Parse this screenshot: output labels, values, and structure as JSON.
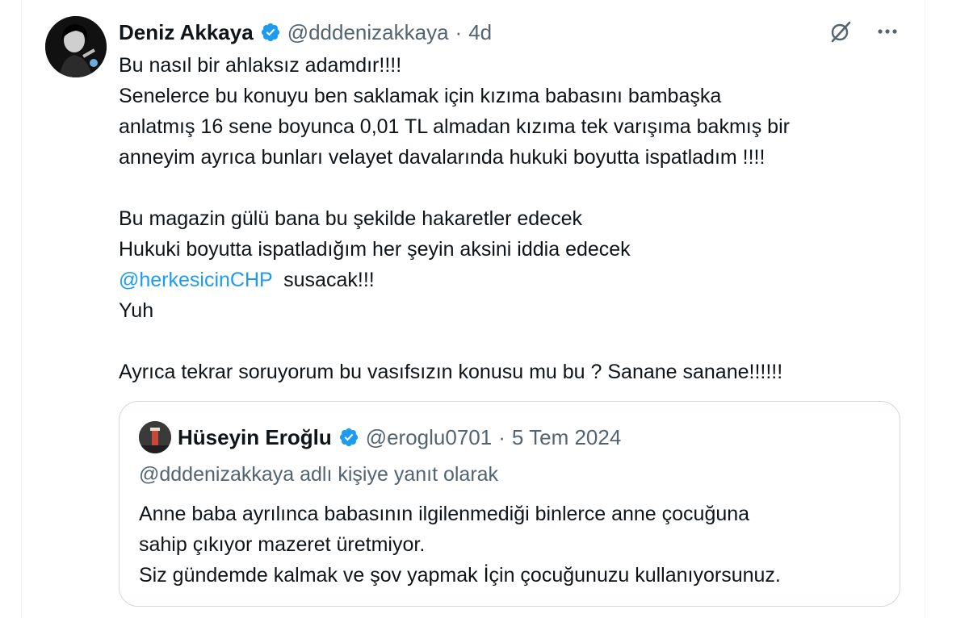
{
  "tweet": {
    "author_name": "Deniz Akkaya",
    "author_handle": "@dddenizakkaya",
    "separator": "·",
    "time": "4d",
    "lines": [
      "Bu nasıl bir ahlaksız adamdır!!!!",
      "Senelerce bu konuyu ben saklamak için kızıma babasını bambaşka",
      "anlatmış 16 sene boyunca 0,01 TL almadan kızıma tek varışıma bakmış bir",
      "anneyim ayrıca bunları velayet davalarında hukuki boyutta ispatladım !!!!",
      "",
      "Bu magazin gülü bana bu şekilde hakaretler edecek",
      "Hukuki boyutta ispatladığım her şeyin aksini iddia edecek"
    ],
    "mention": "@herkesicinCHP",
    "mention_suffix": "  susacak!!!",
    "line_yuh": "Yuh",
    "last_line": "Ayrıca tekrar soruyorum bu vasıfsızın konusu mu bu ? Sanane sanane!!!!!!"
  },
  "quote": {
    "author_name": "Hüseyin Eroğlu",
    "author_handle": "@eroglu0701",
    "separator": "·",
    "time": "5 Tem 2024",
    "reply_context": "@dddenizakkaya adlı kişiye yanıt olarak",
    "lines": [
      "Anne baba ayrılınca babasının ilgilenmediği binlerce anne çocuğuna",
      "sahip çıkıyor mazeret üretmiyor.",
      "Siz gündemde kalmak ve şov yapmak İçin çocuğunuzu kullanıyorsunuz."
    ]
  },
  "icons": {
    "verified": "verified-badge-icon",
    "grok": "grok-icon",
    "more": "more-options-icon"
  },
  "colors": {
    "accent": "#1d9bf0",
    "secondary_text": "#536471",
    "border": "#cfd9de"
  }
}
